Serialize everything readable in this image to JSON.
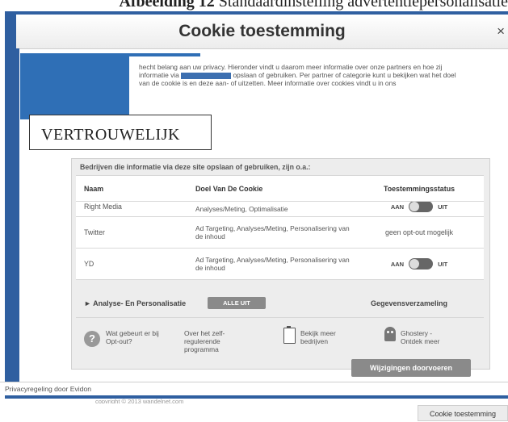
{
  "doc_caption": {
    "bold": "Afbeelding 12",
    "text": " Standaardinstelling advertentiepersonalisatie"
  },
  "modal": {
    "title": "Cookie toestemming",
    "close": "×",
    "intro": {
      "part1": "hecht belang aan uw privacy. Hieronder vindt u daarom meer informatie over onze partners en hoe zij informatie via",
      "part2": "opslaan of gebruiken. Per partner of categorie kunt u bekijken wat het doel van de cookie is en deze aan- of uitzetten. Meer informatie over cookies vindt u in ons"
    },
    "confidential_stamp": "VERTROUWELIJK",
    "panel_heading": "Bedrijven die informatie via deze site opslaan of gebruiken, zijn o.a.:",
    "table": {
      "headers": [
        "Naam",
        "Doel Van De Cookie",
        "Toestemmingsstatus"
      ],
      "rows": [
        {
          "name": "Right Media",
          "purpose": "Analyses/Meting, Optimalisatie",
          "status_on": "AAN",
          "status_off": "UIT"
        },
        {
          "name": "Twitter",
          "purpose": "Ad Targeting, Analyses/Meting, Personalisering van de inhoud",
          "status_text": "geen opt-out mogelijk"
        },
        {
          "name": "YD",
          "purpose": "Ad Targeting, Analyses/Meting, Personalisering van de inhoud",
          "status_on": "AAN",
          "status_off": "UIT"
        }
      ]
    },
    "category": {
      "label": "► Analyse- En Personalisatie",
      "button": "ALLE UIT",
      "right": "Gegevensverzameling"
    },
    "links": [
      {
        "label": "Wat gebeurt er bij Opt-out?",
        "icon": "help-icon"
      },
      {
        "label": "Over het zelf-regulerende programma"
      },
      {
        "label": "Bekijk meer bedrijven",
        "icon": "document-icon"
      },
      {
        "label": "Ghostery - Ontdek meer",
        "icon": "ghost-icon"
      }
    ],
    "apply_button": "Wijzigingen doorvoeren"
  },
  "privacy_bar": "Privacyregeling door Evidon",
  "copyright": "copyright © 2013 wandelnet.com",
  "cookie_tab": "Cookie toestemming"
}
